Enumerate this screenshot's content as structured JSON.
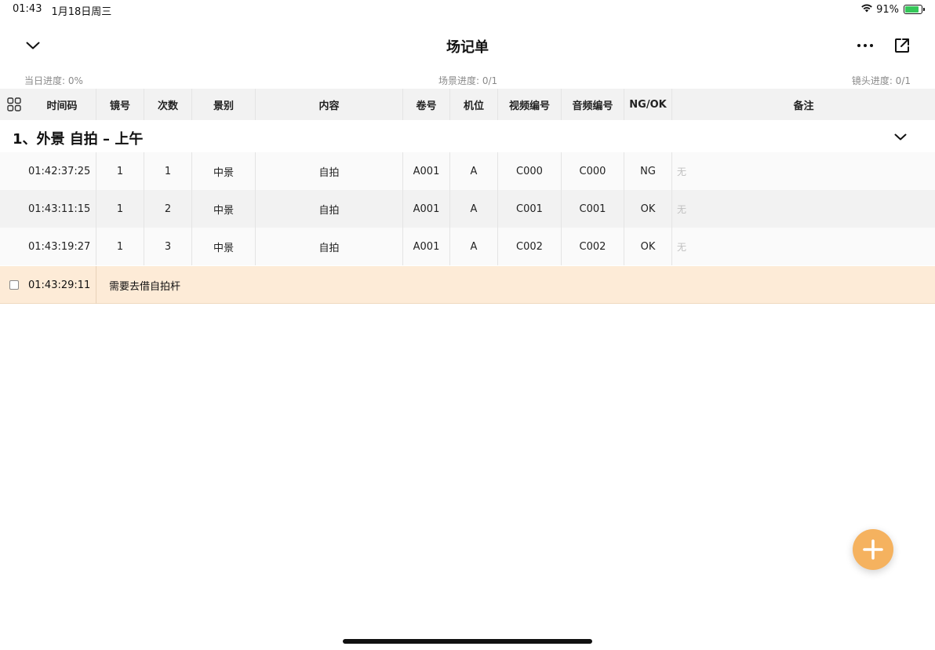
{
  "status_bar": {
    "time": "01:43",
    "date": "1月18日周三",
    "battery": "91%",
    "icons": [
      "wifi-icon",
      "battery-icon"
    ]
  },
  "nav": {
    "title": "场记单",
    "icons": [
      "chevron-down-icon",
      "more-icon",
      "export-icon"
    ]
  },
  "progress": {
    "day": "当日进度: 0%",
    "scene": "场景进度: 0/1",
    "shot": "镜头进度: 0/1"
  },
  "table": {
    "header_icon": "grid-icon",
    "columns": [
      "时间码",
      "镜号",
      "次数",
      "景别",
      "内容",
      "卷号",
      "机位",
      "视频编号",
      "音频编号",
      "NG/OK",
      "备注"
    ]
  },
  "section": {
    "title": "1、外景 自拍 – 上午",
    "icon": "chevron-down-icon"
  },
  "rows": [
    [
      "01:42:37:25",
      "1",
      "1",
      "中景",
      "自拍",
      "A001",
      "A",
      "C000",
      "C000",
      "NG",
      "无"
    ],
    [
      "01:43:11:15",
      "1",
      "2",
      "中景",
      "自拍",
      "A001",
      "A",
      "C001",
      "C001",
      "OK",
      "无"
    ],
    [
      "01:43:19:27",
      "1",
      "3",
      "中景",
      "自拍",
      "A001",
      "A",
      "C002",
      "C002",
      "OK",
      "无"
    ]
  ],
  "note": {
    "time": "01:43:29:11",
    "text": "需要去借自拍杆"
  },
  "colors": {
    "accent": "#f5b25f",
    "note_bg": "#fdebd7",
    "header_bg": "#f2f2f2"
  },
  "fab_icon": "plus-icon"
}
